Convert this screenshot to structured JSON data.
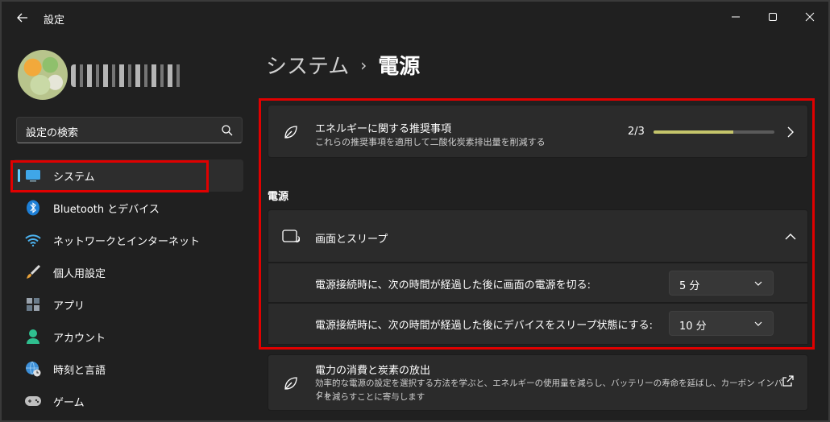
{
  "window": {
    "title": "設定"
  },
  "sidebar": {
    "search": {
      "placeholder": "設定の検索"
    },
    "items": [
      {
        "label": "システム",
        "icon": "monitor-icon",
        "active": true
      },
      {
        "label": "Bluetooth とデバイス",
        "icon": "bluetooth-icon",
        "active": false
      },
      {
        "label": "ネットワークとインターネット",
        "icon": "wifi-icon",
        "active": false
      },
      {
        "label": "個人用設定",
        "icon": "paintbrush-icon",
        "active": false
      },
      {
        "label": "アプリ",
        "icon": "apps-icon",
        "active": false
      },
      {
        "label": "アカウント",
        "icon": "person-icon",
        "active": false
      },
      {
        "label": "時刻と言語",
        "icon": "globe-clock-icon",
        "active": false
      },
      {
        "label": "ゲーム",
        "icon": "gamepad-icon",
        "active": false
      }
    ]
  },
  "main": {
    "breadcrumb": {
      "parent": "システム",
      "separator": "›",
      "current": "電源"
    },
    "recommendations": {
      "title": "エネルギーに関する推奨事項",
      "subtitle": "これらの推奨事項を適用して二酸化炭素排出量を削減する",
      "progress_text": "2/3",
      "progress_fraction": 0.66
    },
    "section_power": "電源",
    "screen_sleep": {
      "title": "画面とスリープ",
      "rows": [
        {
          "label": "電源接続時に、次の時間が経過した後に画面の電源を切る:",
          "value": "5 分"
        },
        {
          "label": "電源接続時に、次の時間が経過した後にデバイスをスリープ状態にする:",
          "value": "10 分"
        }
      ]
    },
    "emissions": {
      "title": "電力の消費と炭素の放出",
      "subtitle_line1": "効率的な電源の設定を選択する方法を学ぶと、エネルギーの使用量を減らし、バッテリーの寿命を延ばし、カーボン インパクト",
      "subtitle_line2": "トを減らすことに寄与します"
    }
  },
  "colors": {
    "background": "#202020",
    "card": "#2b2b2b",
    "accent": "#60cdff",
    "highlight": "#e00000",
    "progress": "#c5c56b"
  }
}
